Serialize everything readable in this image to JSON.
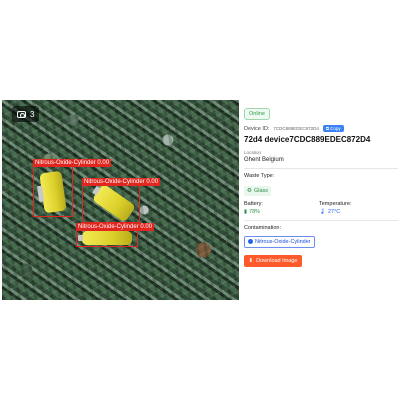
{
  "photo": {
    "count": "3",
    "detections": [
      {
        "label": "Nitrous-Oxide-Cylinder 0.00"
      },
      {
        "label": "Nitrous-Oxide-Cylinder 0.00"
      },
      {
        "label": "Nitrous-Oxide-Cylinder 0.00"
      }
    ]
  },
  "panel": {
    "status": "Online",
    "device_id_label": "Device ID:",
    "device_id_value": "7CDC889EDEC872D4",
    "copy_label": "Copy",
    "device_title": "72d4 device7CDC889EDEC872D4",
    "location_label": "Location",
    "location_value": "Ghent Belgium",
    "waste_type_label": "Waste Type:",
    "waste_type_value": "Glass",
    "battery_label": "Battery:",
    "battery_value": "78%",
    "temperature_label": "Temperature:",
    "temperature_value": "27°C",
    "contamination_label": "Contamination:",
    "contamination_value": "Nitrous-Oxide-Cylinder",
    "download_label": "Download Image"
  },
  "colors": {
    "accent_orange": "#ff5a2c",
    "status_green": "#2e9b48",
    "bbox_red": "#e0261f",
    "link_blue": "#3b82f6"
  }
}
